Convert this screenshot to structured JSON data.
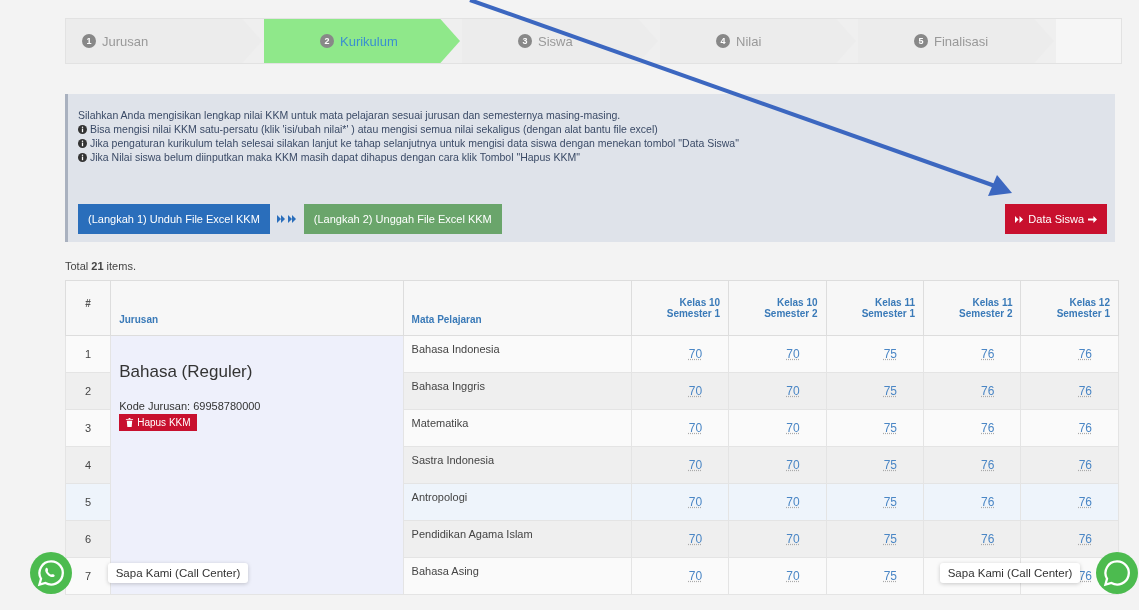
{
  "steps": [
    {
      "number": "1",
      "label": "Jurusan",
      "selected": false
    },
    {
      "number": "2",
      "label": "Kurikulum",
      "selected": true
    },
    {
      "number": "3",
      "label": "Siswa",
      "selected": false
    },
    {
      "number": "4",
      "label": "Nilai",
      "selected": false
    },
    {
      "number": "5",
      "label": "Finalisasi",
      "selected": false
    }
  ],
  "info": {
    "intro": "Silahkan Anda mengisikan lengkap nilai KKM untuk mata pelajaran sesuai jurusan dan semesternya masing-masing.",
    "notes": [
      "Bisa mengisi nilai KKM satu-persatu (klik 'isi/ubah nilai*' ) atau mengisi semua nilai sekaligus (dengan alat bantu file excel)",
      "Jika pengaturan kurikulum telah selesai silakan lanjut ke tahap selanjutnya untuk mengisi data siswa dengan menekan tombol \"Data Siswa\"",
      "Jika Nilai siswa belum diinputkan maka KKM masih dapat dihapus dengan cara klik Tombol \"Hapus KKM\""
    ],
    "download_button": "(Langkah 1) Unduh File Excel KKM",
    "upload_button": "(Langkah 2) Unggah File Excel KKM",
    "next_button": "Data Siswa"
  },
  "summary": "Total **21** items.",
  "table": {
    "columns": [
      "#",
      "Jurusan",
      "Mata Pelajaran",
      "Kelas 10 Semester 1",
      "Kelas 10 Semester 2",
      "Kelas 11 Semester 1",
      "Kelas 11 Semester 2",
      "Kelas 12 Semester 1"
    ],
    "group": {
      "name": "Bahasa (Reguler)",
      "code": "Kode Jurusan: 69958780000",
      "delete_button": "Hapus KKM"
    },
    "rows": [
      {
        "no": "1",
        "subject": "Bahasa Indonesia",
        "values": [
          "70",
          "70",
          "75",
          "76",
          "76"
        ]
      },
      {
        "no": "2",
        "subject": "Bahasa Inggris",
        "values": [
          "70",
          "70",
          "75",
          "76",
          "76"
        ]
      },
      {
        "no": "3",
        "subject": "Matematika",
        "values": [
          "70",
          "70",
          "75",
          "76",
          "76"
        ]
      },
      {
        "no": "4",
        "subject": "Sastra Indonesia",
        "values": [
          "70",
          "70",
          "75",
          "76",
          "76"
        ]
      },
      {
        "no": "5",
        "subject": "Antropologi",
        "values": [
          "70",
          "70",
          "75",
          "76",
          "76"
        ]
      },
      {
        "no": "6",
        "subject": "Pendidikan Agama Islam",
        "values": [
          "70",
          "70",
          "75",
          "76",
          "76"
        ]
      },
      {
        "no": "7",
        "subject": "Bahasa Asing",
        "values": [
          "70",
          "70",
          "75"
        ],
        "kelas_12_semester_1": "76"
      }
    ]
  },
  "chat_widgets": [
    {
      "label": "Sapa Kami (Call Center)"
    },
    {
      "label": "Sapa Kami (Call Center)"
    }
  ]
}
